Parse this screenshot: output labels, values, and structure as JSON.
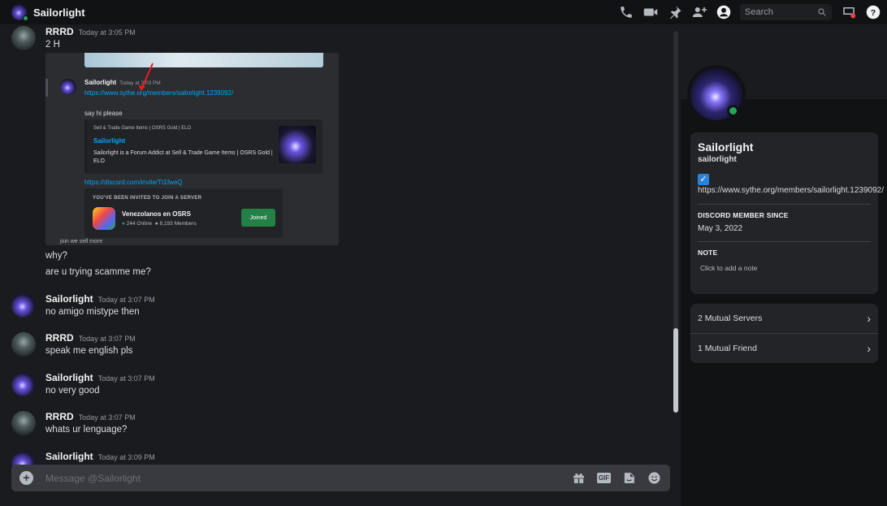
{
  "topbar": {
    "title": "Sailorlight",
    "search_placeholder": "Search",
    "icons": [
      "call-icon",
      "video-icon",
      "pin-icon",
      "add-friend-icon",
      "profile-icon",
      "search-icon",
      "inbox-icon",
      "help-icon"
    ]
  },
  "messages": [
    {
      "author": "RRRD",
      "timestamp": "Today at 3:05 PM",
      "text": "2 H"
    },
    {
      "author": "",
      "timestamp": "",
      "text": "why?"
    },
    {
      "author": "",
      "timestamp": "",
      "text": "are u trying scamme me?"
    },
    {
      "author": "Sailorlight",
      "timestamp": "Today at 3:07 PM",
      "text": "no amigo mistype then"
    },
    {
      "author": "RRRD",
      "timestamp": "Today at 3:07 PM",
      "text": "speak me english pls"
    },
    {
      "author": "Sailorlight",
      "timestamp": "Today at 3:07 PM",
      "text": "no very good"
    },
    {
      "author": "RRRD",
      "timestamp": "Today at 3:07 PM",
      "text": "whats ur lenguage?"
    },
    {
      "author": "Sailorlight",
      "timestamp": "Today at 3:09 PM",
      "text": ""
    }
  ],
  "screenshot": {
    "author": "Sailorlight",
    "timestamp": "Today at 3:03 PM",
    "link": "https://www.sythe.org/members/sailorlight.1239092/",
    "text": "say hi please",
    "embed": {
      "site": "Sell & Trade Game Items | OSRS Gold | ELO",
      "title": "Sailorlight",
      "description": "Sailorlight is a Forum Addict at Sell & Trade Game Items | OSRS Gold | ELO"
    },
    "invite_link": "https://discord.com/invite/Tt1fweQ",
    "invite": {
      "header": "YOU'VE BEEN INVITED TO JOIN A SERVER",
      "server": "Venezolanos en OSRS",
      "online": "244 Online",
      "members": "8,193 Members",
      "button": "Joined"
    },
    "footer": "join we sell more"
  },
  "composer": {
    "placeholder": "Message @Sailorlight",
    "gif_label": "GIF"
  },
  "profile": {
    "display_name": "Sailorlight",
    "username": "sailorlight",
    "about": "https://www.sythe.org/members/sailorlight.1239092/",
    "member_since_label": "DISCORD MEMBER SINCE",
    "member_since": "May 3, 2022",
    "note_label": "NOTE",
    "note_placeholder": "Click to add a note",
    "mutual_servers": "2 Mutual Servers",
    "mutual_friends": "1 Mutual Friend",
    "status_color": "#23a55a"
  }
}
